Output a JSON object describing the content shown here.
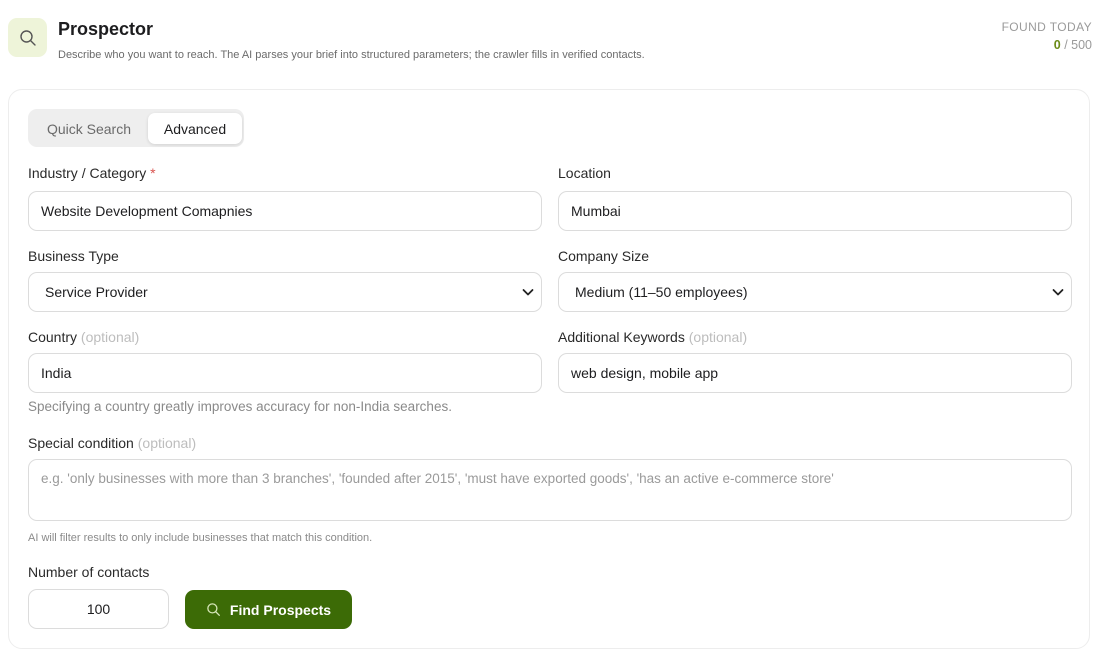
{
  "header": {
    "title": "Prospector",
    "subtitle": "Describe who you want to reach. The AI parses your brief into structured parameters; the crawler fills in verified contacts.",
    "found_label": "FOUND TODAY",
    "found_current": "0",
    "found_separator": " / ",
    "found_limit": "500",
    "logo_icon": "search-icon"
  },
  "tabs": {
    "quick": "Quick Search",
    "advanced": "Advanced",
    "active": "advanced"
  },
  "form": {
    "industry": {
      "label": "Industry / Category",
      "required_mark": "*",
      "value": "Website Development Comapnies"
    },
    "location": {
      "label": "Location",
      "value": "Mumbai"
    },
    "business_type": {
      "label": "Business Type",
      "value": "Service Provider"
    },
    "company_size": {
      "label": "Company Size",
      "value": "Medium (11–50 employees)"
    },
    "country": {
      "label": "Country",
      "optional": "(optional)",
      "value": "India",
      "hint": "Specifying a country greatly improves accuracy for non-India searches."
    },
    "keywords": {
      "label": "Additional Keywords",
      "optional": "(optional)",
      "value": "web design, mobile app"
    },
    "special_condition": {
      "label": "Special condition",
      "optional": "(optional)",
      "placeholder": "e.g. 'only businesses with more than 3 branches', 'founded after 2015', 'must have exported goods', 'has an active e-commerce store'",
      "hint": "AI will filter results to only include businesses that match this condition."
    },
    "contacts": {
      "label": "Number of contacts",
      "value": "100"
    },
    "submit_label": "Find Prospects"
  },
  "colors": {
    "accent": "#3c6b06",
    "found_current": "#6b8b17",
    "logo_bg": "#eef4d9"
  }
}
